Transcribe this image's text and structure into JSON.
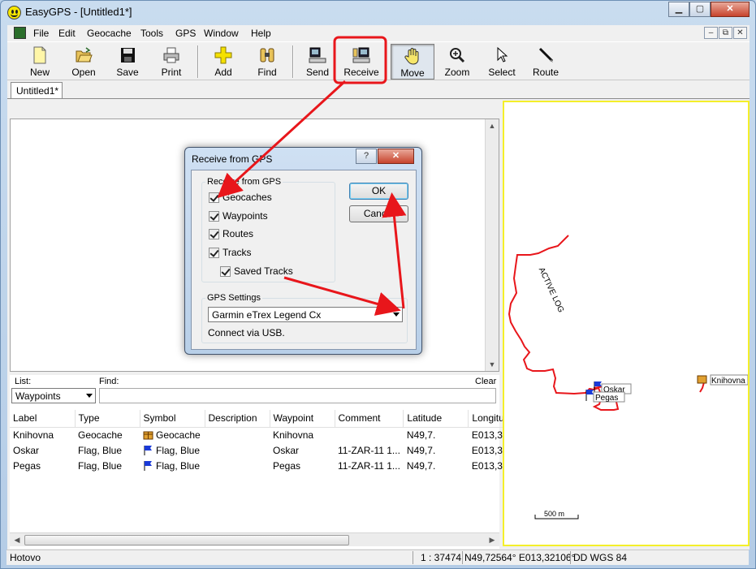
{
  "window": {
    "title": "EasyGPS - [Untitled1*]",
    "minimize": "▁",
    "maximize": "▢",
    "close": "✕"
  },
  "menu": {
    "items": [
      "File",
      "Edit",
      "Geocache",
      "Tools",
      "GPS",
      "Window",
      "Help"
    ],
    "mdi": [
      "–",
      "⧉",
      "✕"
    ]
  },
  "toolbar": {
    "new": "New",
    "open": "Open",
    "save": "Save",
    "print": "Print",
    "add": "Add",
    "find": "Find",
    "send": "Send",
    "receive": "Receive",
    "move_map": "Move Map",
    "zoom": "Zoom",
    "select": "Select",
    "route": "Route"
  },
  "tabs": [
    "Untitled1*"
  ],
  "list_panel": {
    "list_label": "List:",
    "find_label": "Find:",
    "clear_label": "Clear",
    "list_selected": "Waypoints",
    "columns": [
      "Label",
      "Type",
      "Symbol",
      "Description",
      "Waypoint",
      "Comment",
      "Latitude",
      "Longitu"
    ],
    "rows": [
      {
        "label": "Knihovna",
        "type": "Geocache",
        "symbol": "Geocache",
        "description": "",
        "waypoint": "Knihovna",
        "comment": "",
        "latitude": "N49,7.",
        "longitude": "E013,3"
      },
      {
        "label": "Oskar",
        "type": "Flag, Blue",
        "symbol": "Flag, Blue",
        "description": "",
        "waypoint": "Oskar",
        "comment": "11-ZAR-11 1...",
        "latitude": "N49,7.",
        "longitude": "E013,3"
      },
      {
        "label": "Pegas",
        "type": "Flag, Blue",
        "symbol": "Flag, Blue",
        "description": "",
        "waypoint": "Pegas",
        "comment": "11-ZAR-11 1...",
        "latitude": "N49,7.",
        "longitude": "E013,3"
      }
    ]
  },
  "map": {
    "track_label": "ACTIVE LOG",
    "waypoints": [
      "Oskar",
      "Pegas",
      "Knihovna"
    ],
    "scale": "500 m"
  },
  "status": {
    "text": "Hotovo",
    "scale": "1 : 37474",
    "coords": "N49,72564° E013,32106°",
    "datum": "DD WGS 84"
  },
  "dialog": {
    "title": "Receive from GPS",
    "help": "?",
    "close": "✕",
    "group_receive": "Receive from GPS",
    "checks": [
      "Geocaches",
      "Waypoints",
      "Routes",
      "Tracks",
      "Saved Tracks"
    ],
    "ok": "OK",
    "cancel": "Cancel",
    "group_gps": "GPS Settings",
    "gps_model": "Garmin eTrex Legend Cx",
    "connect_note": "Connect via USB."
  },
  "colors": {
    "annotation_red": "#e8161b",
    "track_red": "#e8161b",
    "map_border": "#f4ef2a"
  }
}
